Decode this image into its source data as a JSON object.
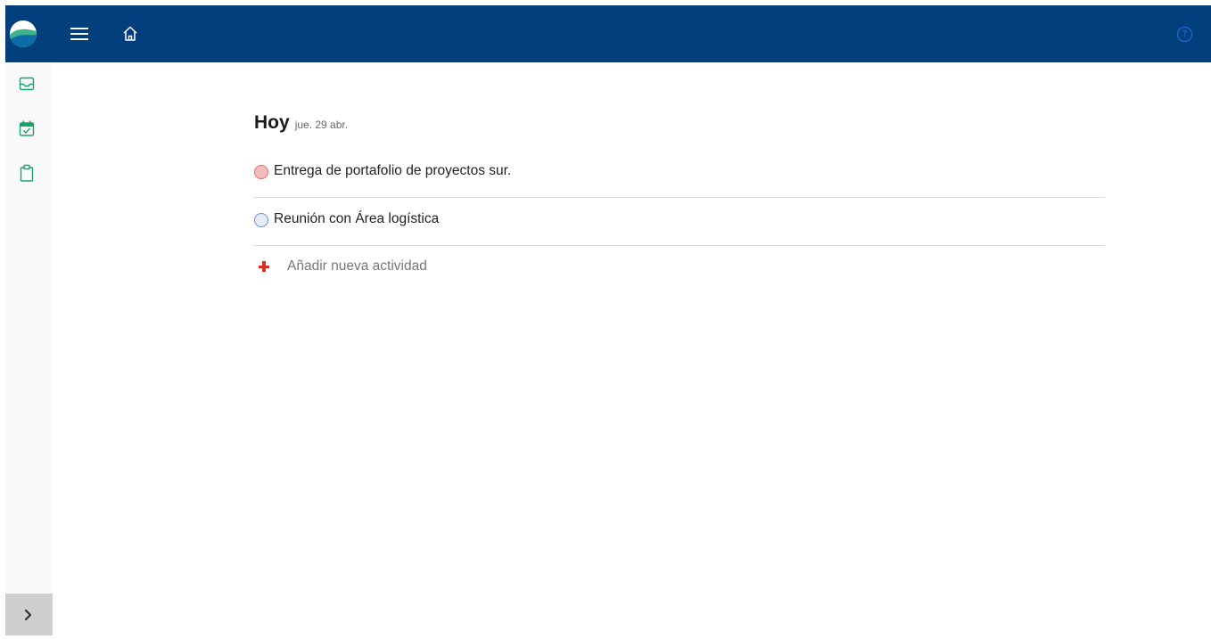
{
  "colors": {
    "topbar": "#003f7b",
    "accent_green": "#1aa26a",
    "help_blue": "#1a73e8",
    "task_red": "#f4bcbc",
    "task_blue": "#e4ecf8",
    "add_red": "#d93025"
  },
  "topbar": {
    "icons": [
      "app-logo",
      "hamburger-menu-icon",
      "home-icon",
      "help-icon"
    ],
    "help_label": "?"
  },
  "sidebar": {
    "items": [
      {
        "icon": "inbox-icon"
      },
      {
        "icon": "calendar-check-icon"
      },
      {
        "icon": "clipboard-icon"
      }
    ],
    "expand_icon": "chevron-right-icon"
  },
  "main": {
    "title": "Hoy",
    "date": "jue. 29 abr.",
    "tasks": [
      {
        "label": "Entrega de portafolio de proyectos sur.",
        "status_color": "#f4bcbc"
      },
      {
        "label": "Reunión con Área logística",
        "status_color": "#e4ecf8"
      }
    ],
    "add_label": "Añadir nueva actividad"
  }
}
